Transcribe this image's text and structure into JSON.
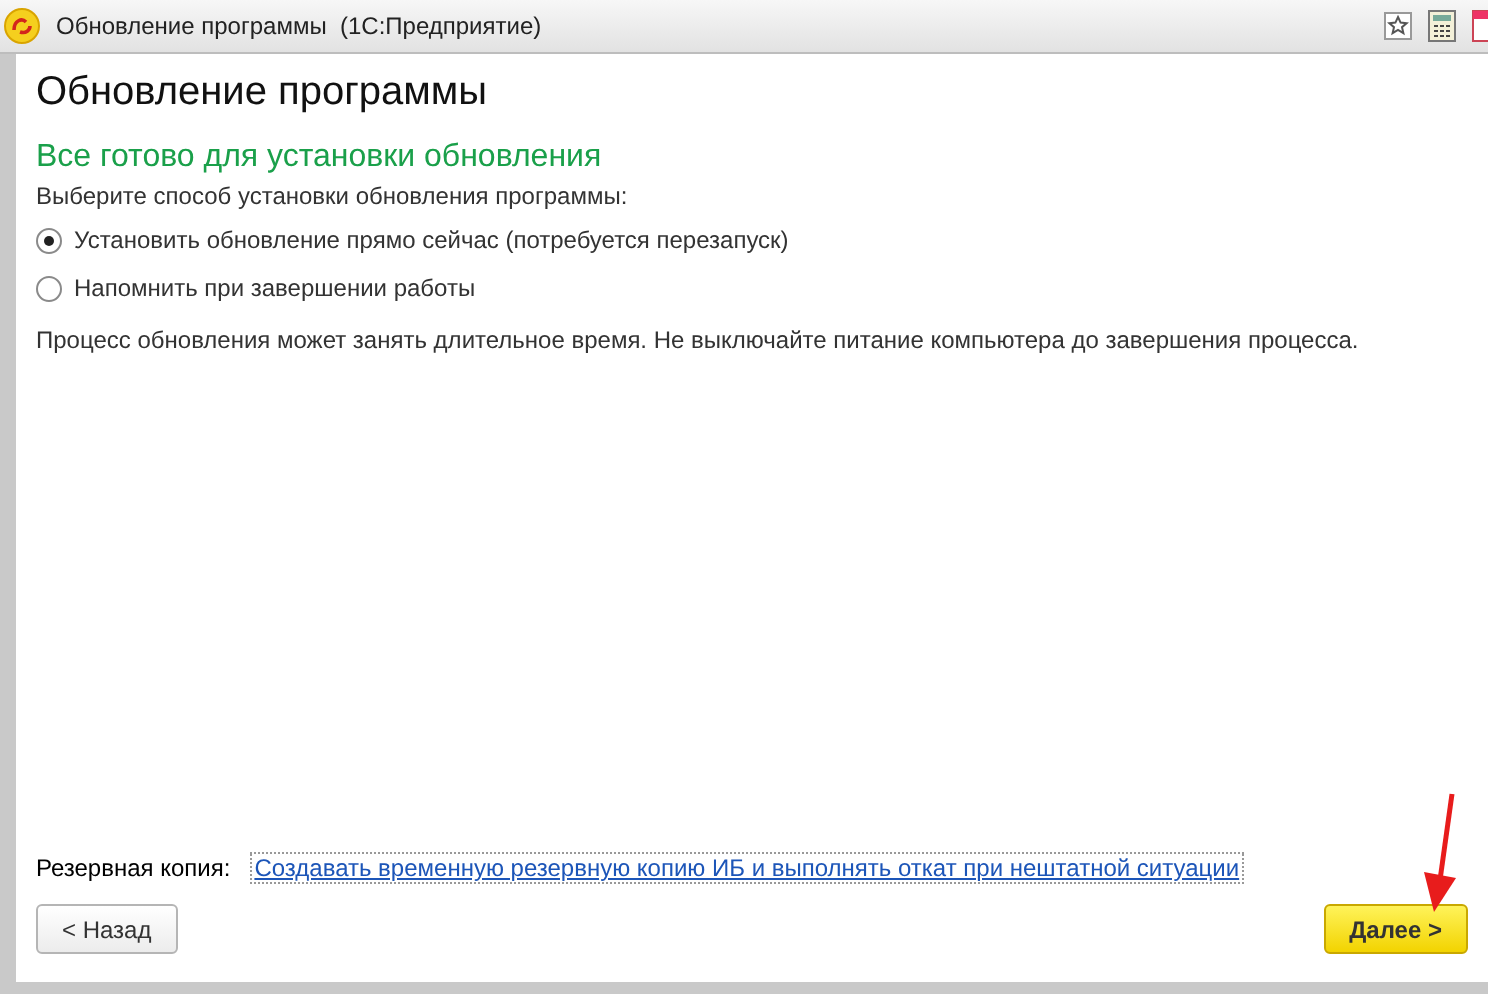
{
  "window": {
    "title": "Обновление программы  (1С:Предприятие)"
  },
  "heading": "Обновление программы",
  "subheading": "Все готово для установки обновления",
  "prompt": "Выберите способ установки обновления программы:",
  "options": [
    {
      "label": "Установить обновление прямо сейчас (потребуется перезапуск)",
      "selected": true
    },
    {
      "label": "Напомнить при завершении работы",
      "selected": false
    }
  ],
  "note": "Процесс обновления может занять длительное время. Не выключайте питание компьютера до завершения процесса.",
  "backup": {
    "label": "Резервная копия:",
    "link": "Создавать временную резервную копию ИБ и выполнять откат при нештатной ситуации"
  },
  "buttons": [
    {
      "label": "< Назад",
      "kind": "secondary"
    },
    {
      "label": "Далее >",
      "kind": "primary"
    }
  ]
}
